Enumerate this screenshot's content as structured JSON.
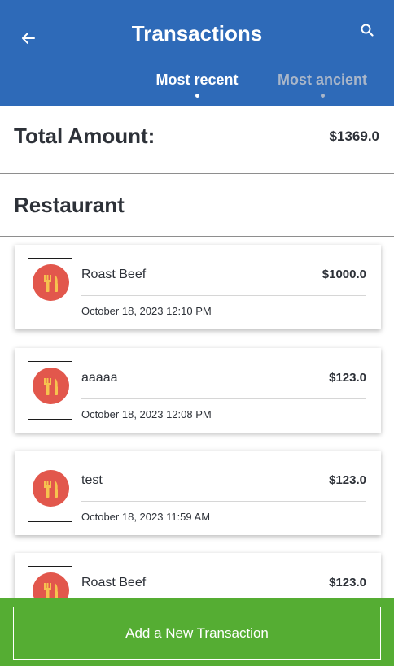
{
  "header": {
    "title": "Transactions",
    "back_icon": "arrow-left-icon",
    "search_icon": "search-icon",
    "color": "#2e6ab8"
  },
  "tabs": [
    {
      "label": "Most recent",
      "active": true
    },
    {
      "label": "Most ancient",
      "active": false
    }
  ],
  "summary": {
    "total_label": "Total Amount:",
    "total_value": "$1369.0"
  },
  "category": {
    "label": "Restaurant",
    "icon": "fork-knife-icon",
    "icon_color": "#e2574c"
  },
  "transactions": [
    {
      "name": "Roast Beef",
      "amount": "$1000.0",
      "date": "October 18, 2023 12:10 PM"
    },
    {
      "name": "aaaaa",
      "amount": "$123.0",
      "date": "October 18, 2023 12:08 PM"
    },
    {
      "name": "test",
      "amount": "$123.0",
      "date": "October 18, 2023 11:59 AM"
    },
    {
      "name": "Roast Beef",
      "amount": "$123.0",
      "date": ""
    }
  ],
  "footer": {
    "add_label": "Add a New Transaction",
    "color": "#55ad33"
  }
}
